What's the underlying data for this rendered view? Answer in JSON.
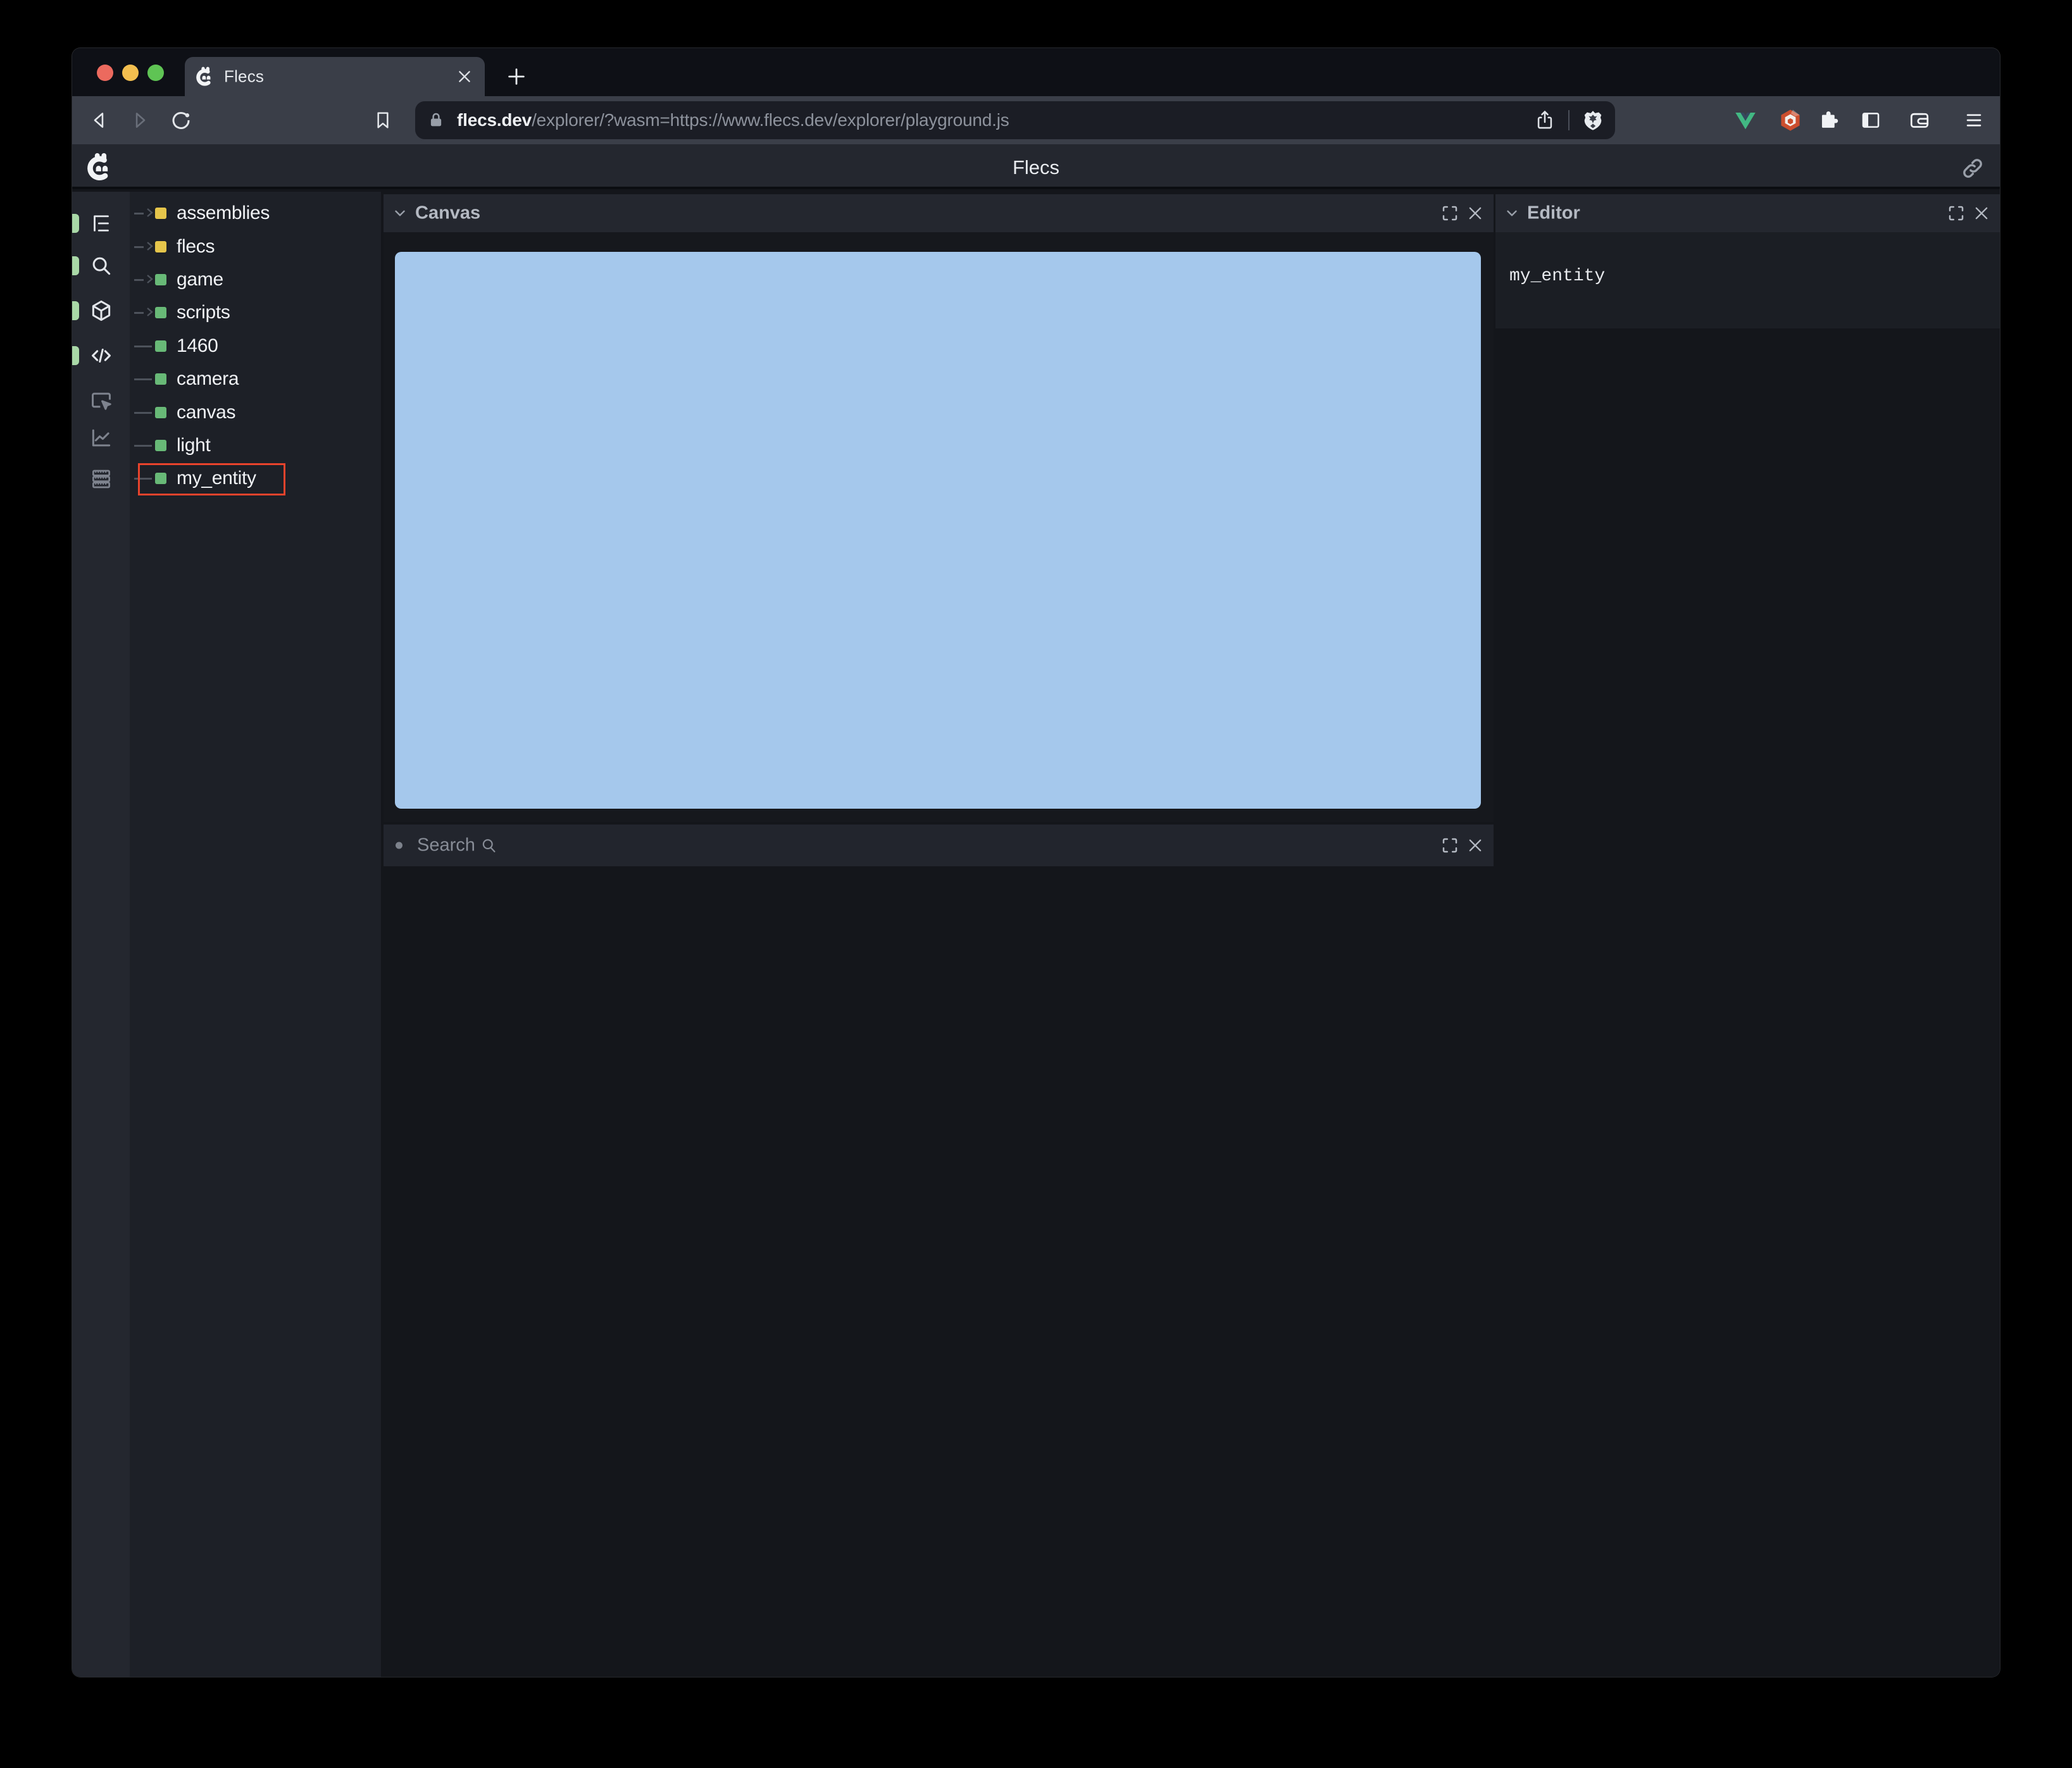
{
  "browser": {
    "traffic_lights": {
      "close": "#ec6a5e",
      "minimize": "#f3bf4f",
      "zoom": "#5fc454"
    },
    "tab": {
      "title": "Flecs"
    },
    "address": {
      "domain": "flecs.dev",
      "path": "/explorer/?wasm=https://www.flecs.dev/explorer/playground.js"
    }
  },
  "page": {
    "header": {
      "title": "Flecs"
    },
    "sidebar": {
      "items": [
        {
          "icon": "tree-view"
        },
        {
          "icon": "search"
        },
        {
          "icon": "entities"
        },
        {
          "icon": "code"
        },
        {
          "icon": "inspector"
        },
        {
          "icon": "statistics"
        },
        {
          "icon": "data"
        }
      ]
    },
    "tree": {
      "items": [
        {
          "label": "assemblies",
          "color": "#e5c54b",
          "expandable": true,
          "selected": false
        },
        {
          "label": "flecs",
          "color": "#e5c54b",
          "expandable": true,
          "selected": false
        },
        {
          "label": "game",
          "color": "#68b977",
          "expandable": true,
          "selected": false
        },
        {
          "label": "scripts",
          "color": "#68b977",
          "expandable": true,
          "selected": false
        },
        {
          "label": "1460",
          "color": "#68b977",
          "expandable": false,
          "selected": false
        },
        {
          "label": "camera",
          "color": "#68b977",
          "expandable": false,
          "selected": false
        },
        {
          "label": "canvas",
          "color": "#68b977",
          "expandable": false,
          "selected": false
        },
        {
          "label": "light",
          "color": "#68b977",
          "expandable": false,
          "selected": false
        },
        {
          "label": "my_entity",
          "color": "#68b977",
          "expandable": false,
          "selected": true
        }
      ]
    },
    "panels": {
      "canvas": {
        "title": "Canvas",
        "canvas_color": "#a5c8ec"
      },
      "search": {
        "title": "Search"
      },
      "editor": {
        "title": "Editor",
        "content": "my_entity"
      }
    }
  },
  "colors": {
    "selection_outline": "#e8432c",
    "rail_indicator": "#a9d8a7",
    "canvas_blue": "#a5c8ec"
  }
}
